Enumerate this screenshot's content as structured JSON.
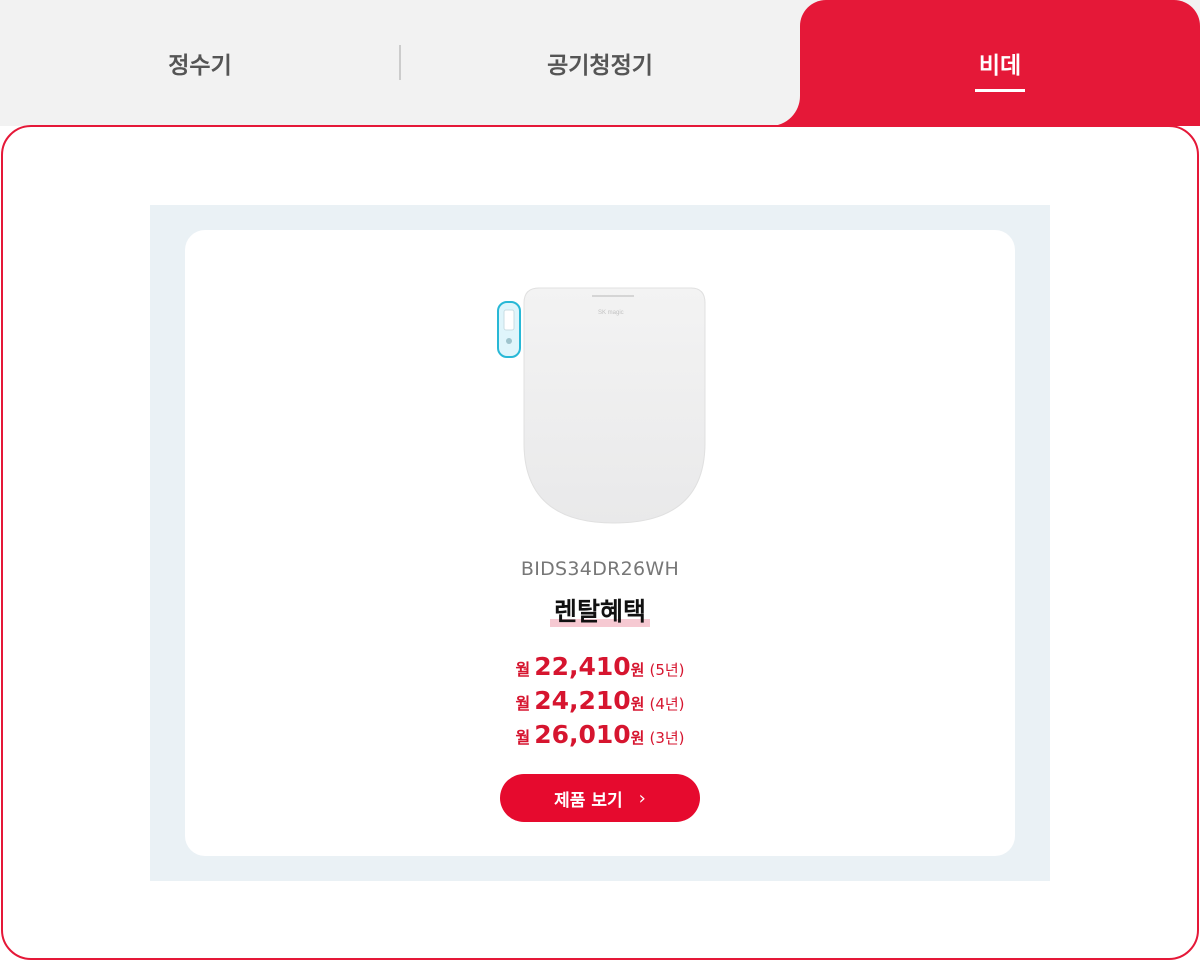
{
  "tabs": [
    {
      "label": "정수기",
      "active": false
    },
    {
      "label": "공기청정기",
      "active": false
    },
    {
      "label": "비데",
      "active": true
    }
  ],
  "colors": {
    "accent": "#e51838",
    "button": "#e60a2e",
    "price": "#d6152f",
    "box_bg": "#eaf1f5",
    "tab_bg": "#f2f2f2"
  },
  "product": {
    "model": "BIDS34DR26WH",
    "benefit_title": "렌탈혜택",
    "image_logo_text": "SK magic",
    "prices": [
      {
        "prefix": "월",
        "value": "22,410",
        "unit": "원",
        "period": "(5년)"
      },
      {
        "prefix": "월",
        "value": "24,210",
        "unit": "원",
        "period": "(4년)"
      },
      {
        "prefix": "월",
        "value": "26,010",
        "unit": "원",
        "period": "(3년)"
      }
    ],
    "button_label": "제품 보기",
    "button_icon": "chevron-right-icon"
  }
}
